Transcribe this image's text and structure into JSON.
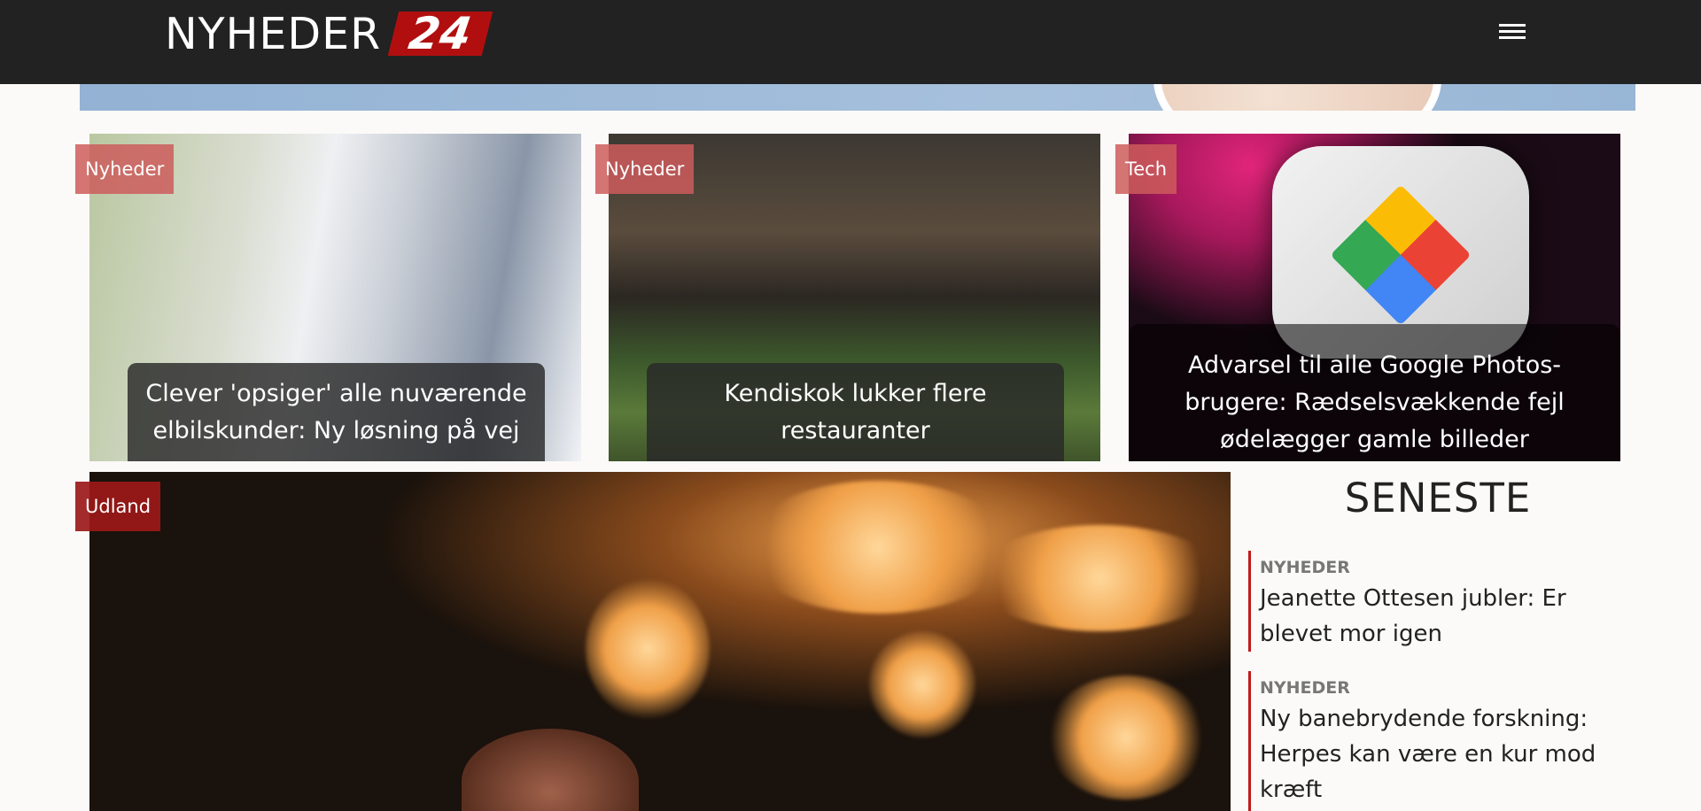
{
  "header": {
    "logo_text": "NYHEDER",
    "logo_badge": "24",
    "menu_icon": "hamburger-menu-icon"
  },
  "top_cards": [
    {
      "category": "Nyheder",
      "title": "Clever 'opsiger' alle nuværende elbilskunder: Ny løsning på vej"
    },
    {
      "category": "Nyheder",
      "title": "Kendiskok lukker flere restauranter"
    },
    {
      "category": "Tech",
      "title": "Advarsel til alle Google Photos-brugere: Rædselsvækkende fejl ødelægger gamle billeder"
    }
  ],
  "feature": {
    "category": "Udland"
  },
  "sidebar": {
    "heading": "SENESTE",
    "items": [
      {
        "category": "NYHEDER",
        "title": "Jeanette Ottesen jubler: Er blevet mor igen"
      },
      {
        "category": "NYHEDER",
        "title": "Ny banebrydende forskning: Herpes kan være en kur mod kræft"
      }
    ]
  },
  "colors": {
    "header_bg": "#222222",
    "accent": "#c11a1a",
    "tag_bg": "#cd5c5c",
    "tag_dark_bg": "#9b1919"
  }
}
